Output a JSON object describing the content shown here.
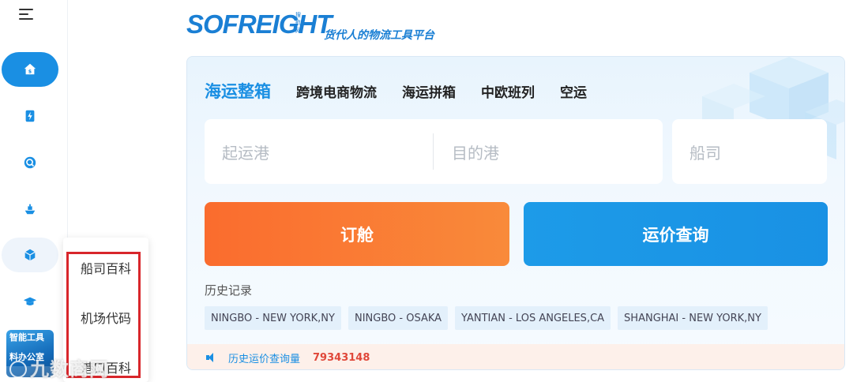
{
  "sidebar": {
    "icons": [
      {
        "name": "home-icon"
      },
      {
        "name": "bolt-document-icon"
      },
      {
        "name": "search-circle-icon"
      },
      {
        "name": "ship-icon"
      },
      {
        "name": "box-icon"
      },
      {
        "name": "graduation-cap-icon"
      }
    ],
    "smart_tool": {
      "line1": "智能工具",
      "line2": "料办公室"
    },
    "watermark": "九数商网"
  },
  "dropdown": {
    "items": [
      "船司百科",
      "机场代码",
      "港口百科"
    ]
  },
  "logo": {
    "brand": "SOFREIGHT",
    "tagline": "货代人的物流工具平台",
    "tag_small": "搜航网"
  },
  "tabs": [
    {
      "label": "海运整箱",
      "active": true
    },
    {
      "label": "跨境电商物流",
      "active": false
    },
    {
      "label": "海运拼箱",
      "active": false
    },
    {
      "label": "中欧班列",
      "active": false
    },
    {
      "label": "空运",
      "active": false
    }
  ],
  "search": {
    "origin_placeholder": "起运港",
    "destination_placeholder": "目的港",
    "carrier_placeholder": "船司"
  },
  "buttons": {
    "book": "订舱",
    "rate_query": "运价查询"
  },
  "history": {
    "title": "历史记录",
    "items": [
      "NINGBO - NEW YORK,NY",
      "NINGBO - OSAKA",
      "YANTIAN - LOS ANGELES,CA",
      "SHANGHAI - NEW YORK,NY"
    ]
  },
  "stats": {
    "label": "历史运价查询量",
    "value": "79343148"
  },
  "colors": {
    "accent": "#1a8fe3",
    "book_orange": "#fa6c2e",
    "highlight_red": "#d8262b",
    "stat_red": "#e0483a"
  }
}
